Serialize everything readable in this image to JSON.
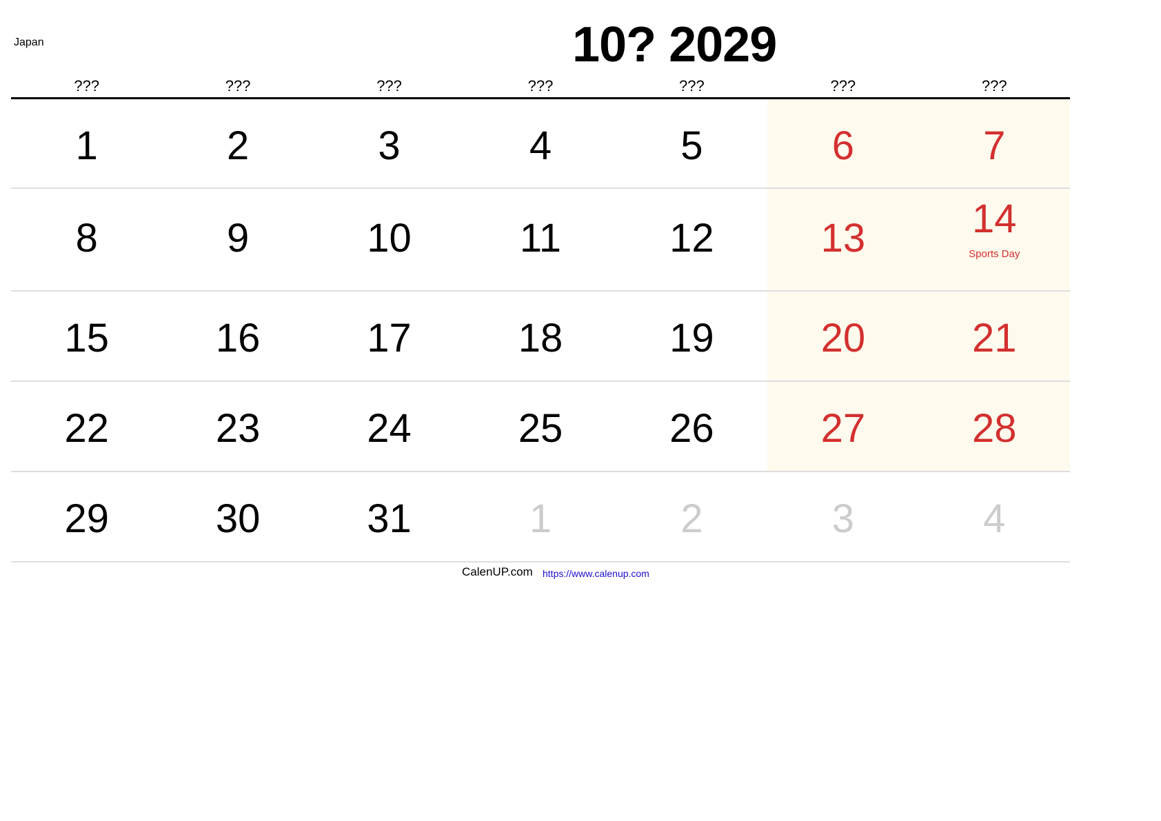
{
  "header": {
    "country": "Japan",
    "title": "10? 2029"
  },
  "weekdays": [
    "???",
    "???",
    "???",
    "???",
    "???",
    "???",
    "???"
  ],
  "weeks": [
    [
      {
        "day": "1",
        "type": "normal"
      },
      {
        "day": "2",
        "type": "normal"
      },
      {
        "day": "3",
        "type": "normal"
      },
      {
        "day": "4",
        "type": "normal"
      },
      {
        "day": "5",
        "type": "normal"
      },
      {
        "day": "6",
        "type": "weekend"
      },
      {
        "day": "7",
        "type": "weekend"
      }
    ],
    [
      {
        "day": "8",
        "type": "normal"
      },
      {
        "day": "9",
        "type": "normal"
      },
      {
        "day": "10",
        "type": "normal"
      },
      {
        "day": "11",
        "type": "normal"
      },
      {
        "day": "12",
        "type": "normal"
      },
      {
        "day": "13",
        "type": "weekend"
      },
      {
        "day": "14",
        "type": "weekend",
        "holiday": "Sports Day"
      }
    ],
    [
      {
        "day": "15",
        "type": "normal"
      },
      {
        "day": "16",
        "type": "normal"
      },
      {
        "day": "17",
        "type": "normal"
      },
      {
        "day": "18",
        "type": "normal"
      },
      {
        "day": "19",
        "type": "normal"
      },
      {
        "day": "20",
        "type": "weekend"
      },
      {
        "day": "21",
        "type": "weekend"
      }
    ],
    [
      {
        "day": "22",
        "type": "normal"
      },
      {
        "day": "23",
        "type": "normal"
      },
      {
        "day": "24",
        "type": "normal"
      },
      {
        "day": "25",
        "type": "normal"
      },
      {
        "day": "26",
        "type": "normal"
      },
      {
        "day": "27",
        "type": "weekend"
      },
      {
        "day": "28",
        "type": "weekend"
      }
    ],
    [
      {
        "day": "29",
        "type": "normal"
      },
      {
        "day": "30",
        "type": "normal"
      },
      {
        "day": "31",
        "type": "normal"
      },
      {
        "day": "1",
        "type": "other"
      },
      {
        "day": "2",
        "type": "other"
      },
      {
        "day": "3",
        "type": "other"
      },
      {
        "day": "4",
        "type": "other"
      }
    ]
  ],
  "footer": {
    "brand": "CalenUP.com",
    "link": "https://www.calenup.com"
  },
  "colors": {
    "weekend_text": "#d32f2f",
    "weekend_bg": "#fefaed",
    "other_month_text": "#cccccc",
    "link": "#1a0dcc"
  }
}
